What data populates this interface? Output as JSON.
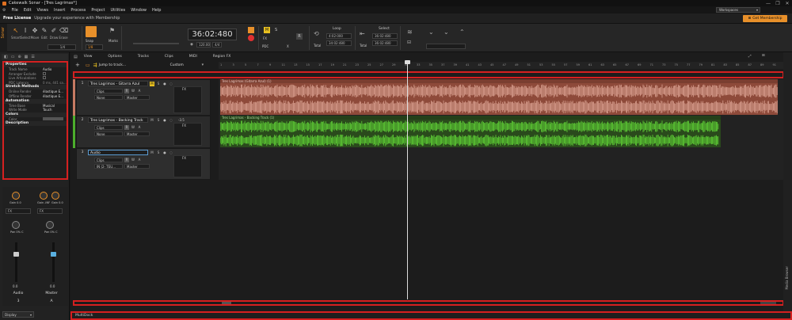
{
  "window": {
    "title": "Cakewalk Sonar - [Tres Lagrimas*]",
    "minimize": "—",
    "maximize": "❐",
    "close": "✕"
  },
  "menu": [
    "File",
    "Edit",
    "Views",
    "Insert",
    "Process",
    "Project",
    "Utilities",
    "Window",
    "Help"
  ],
  "workspace": {
    "label": "Workspaces"
  },
  "banner": {
    "title": "Free License",
    "message": "Upgrade your experience with Membership",
    "button": "Get Membership"
  },
  "controlbar": {
    "tools": [
      {
        "label": "Smart",
        "icon": "smart-tool-icon",
        "glyph": "↖"
      },
      {
        "label": "Select",
        "icon": "select-tool-icon",
        "glyph": "I"
      },
      {
        "label": "Move",
        "icon": "move-tool-icon",
        "glyph": "✥"
      },
      {
        "label": "Edit",
        "icon": "edit-tool-icon",
        "glyph": "✎"
      },
      {
        "label": "Draw",
        "icon": "draw-tool-icon",
        "glyph": "✐"
      },
      {
        "label": "Erase",
        "icon": "erase-tool-icon",
        "glyph": "⌫"
      }
    ],
    "tool_value": "1/4",
    "snap_label": "Snap",
    "snap_value": "1/8",
    "marks_label": "Marks",
    "time": "36:02:480",
    "tempo": "120.00",
    "meter": "4/4",
    "loop_label": "Loop",
    "loop_start": "4:02:000",
    "loop_end": "34:02:480",
    "select_label": "Select",
    "select_start": "36:02:480",
    "select_end": "36:02:480",
    "total_label": "Total",
    "m_label": "M",
    "s_label": "S",
    "r_label": "R",
    "fx_label": "FX",
    "pdc_label": "PDC",
    "x_label": "X"
  },
  "inspector": {
    "sections": [
      {
        "title": "Properties",
        "rows": [
          {
            "name": "Track Name",
            "value": "Audio"
          },
          {
            "name": "Arranger Exclude",
            "value": ""
          },
          {
            "name": "Live Articulations",
            "value": ""
          },
          {
            "name": "PDC Latency",
            "value": "0 ms, 441 sa..."
          }
        ]
      },
      {
        "title": "Stretch Methods",
        "rows": [
          {
            "name": "Online Render",
            "value": "élastique E..."
          },
          {
            "name": "Offline Render",
            "value": "élastique E..."
          }
        ]
      },
      {
        "title": "Automation",
        "rows": [
          {
            "name": "Time Base",
            "value": "Musical"
          },
          {
            "name": "Write Mode",
            "value": "Touch"
          }
        ]
      },
      {
        "title": "Colors",
        "rows": [
          {
            "name": "Color",
            "value": ""
          }
        ]
      },
      {
        "title": "Description",
        "rows": []
      }
    ],
    "strips": [
      {
        "name": "Audio",
        "gain": "Gain 0.0",
        "pan": "Pan 0% C",
        "vol": "0.0",
        "index": "3"
      },
      {
        "name": "Master",
        "gain": "Gain -INF",
        "gain2": "Gain 0.0",
        "pan": "Pan 0% C",
        "vol": "0.0",
        "index": "A"
      }
    ],
    "fx_label": "FX",
    "display_label": "Display"
  },
  "trackview": {
    "menus": [
      "View",
      "Options",
      "Tracks",
      "Clips",
      "MIDI",
      "Region FX"
    ],
    "jump_placeholder": "Jump to track...",
    "custom_label": "Custom",
    "ruler": [
      "1",
      "3",
      "5",
      "7",
      "9",
      "11",
      "13",
      "15",
      "17",
      "19",
      "21",
      "23",
      "25",
      "27",
      "29",
      "31",
      "33",
      "35",
      "37",
      "39",
      "41",
      "43",
      "45",
      "47",
      "49",
      "51",
      "53",
      "55",
      "57",
      "59",
      "61",
      "63",
      "65",
      "67",
      "69",
      "71",
      "73",
      "75",
      "77",
      "79",
      "81",
      "83",
      "85",
      "87",
      "89",
      "91"
    ],
    "tracks": [
      {
        "num": "1",
        "name": "Tres Lagrimas - Gitarra Azul",
        "mode": "Clips",
        "input": "None",
        "output": "Master",
        "clip": "Tres Lagrimas (Gitarra Azul) (1)",
        "color": "#c67a62",
        "wave": "#d9a090"
      },
      {
        "num": "2",
        "name": "Tres Lagrimas - Backing Track",
        "mode": "Clips",
        "input": "None",
        "output": "Master",
        "clip": "Tres Lagrimas - Backing Track (1)",
        "color": "#3a7a22",
        "wave": "#5fd236",
        "vol": "-3.5"
      },
      {
        "num": "3",
        "name": "Audio",
        "mode": "Clips",
        "input": "IN (2- TEU…",
        "output": "Master"
      }
    ],
    "multidock": "MultiDock",
    "vscroll_label": "Media Browser"
  },
  "colors": {
    "accent": "#e8902a",
    "red_box": "#d42020",
    "bg": "#1a1a1a"
  }
}
